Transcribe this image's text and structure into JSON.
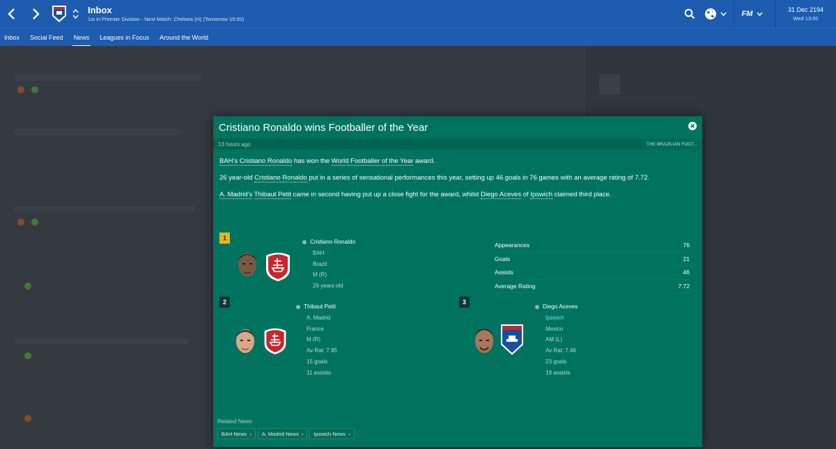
{
  "header": {
    "title": "Inbox",
    "subtitle": "1st in Premier Division - Next Match: Chelsea (H) (Tomorrow 15:00)",
    "date": "31 Dec 2194",
    "weekday_time": "Wed 13:00",
    "accent_color": "#1d5cae"
  },
  "icons": {
    "back": "chevron-left-icon",
    "forward": "chevron-right-icon",
    "search": "search-icon",
    "world": "globe-icon",
    "fm": "fm-logo-icon"
  },
  "fm_label": "FM",
  "tabs": [
    {
      "label": "Inbox",
      "active": false
    },
    {
      "label": "Social Feed",
      "active": false
    },
    {
      "label": "News",
      "active": true
    },
    {
      "label": "Leagues in Focus",
      "active": false
    },
    {
      "label": "Around the World",
      "active": false
    }
  ],
  "article": {
    "headline": "Cristiano Ronaldo wins Footballer of the Year",
    "time_ago": "13 hours ago",
    "source": "THE BRAZILIAN FOOT...",
    "p1": {
      "club_possessive": "BAH's",
      "player": "Cristiano Ronaldo",
      "mid": "has won the",
      "award": "World Footballer of the Year",
      "end": "award."
    },
    "p2": {
      "start": "26 year-old",
      "player": "Cristiano Ronaldo",
      "rest": "put in a series of sensational performances this year, setting up 46 goals in 76 games with an average rating of 7.72."
    },
    "p3": {
      "club": "A. Madrid's",
      "player2": "Thibaut Petit",
      "mid": "came in second having put up a close fight for the award, whilst",
      "player3": "Diego Aceves",
      "of": "of",
      "club3": "Ipswich",
      "end": "claimed third place."
    }
  },
  "winners": [
    {
      "rank": "1",
      "name": "Cristiano Ronaldo",
      "club": "BAH",
      "nation": "Brazil",
      "position": "M (R)",
      "age": "26 years old"
    },
    {
      "rank": "2",
      "name": "Thibaut Petit",
      "club": "A. Madrid",
      "nation": "France",
      "position": "M (R)",
      "rating": "Av Rat: 7.95",
      "goals": "15 goals",
      "assists": "11 assists"
    },
    {
      "rank": "3",
      "name": "Diego Aceves",
      "club": "Ipswich",
      "nation": "Mexico",
      "position": "AM (L)",
      "rating": "Av Rat: 7.46",
      "goals": "23 goals",
      "assists": "19 assists"
    }
  ],
  "stats": [
    {
      "label": "Appearances",
      "value": "76"
    },
    {
      "label": "Goals",
      "value": "21"
    },
    {
      "label": "Assists",
      "value": "46"
    },
    {
      "label": "Average Rating",
      "value": "7.72"
    }
  ],
  "related": {
    "label": "Related News",
    "links": [
      "BAH News",
      "A. Madrid News",
      "Ipswich News"
    ]
  },
  "colors": {
    "modal_bg": "#00735f",
    "rank_gold": "#e8b421",
    "club_red": "#c8262c",
    "ipswich_blue": "#1c4e9e"
  }
}
